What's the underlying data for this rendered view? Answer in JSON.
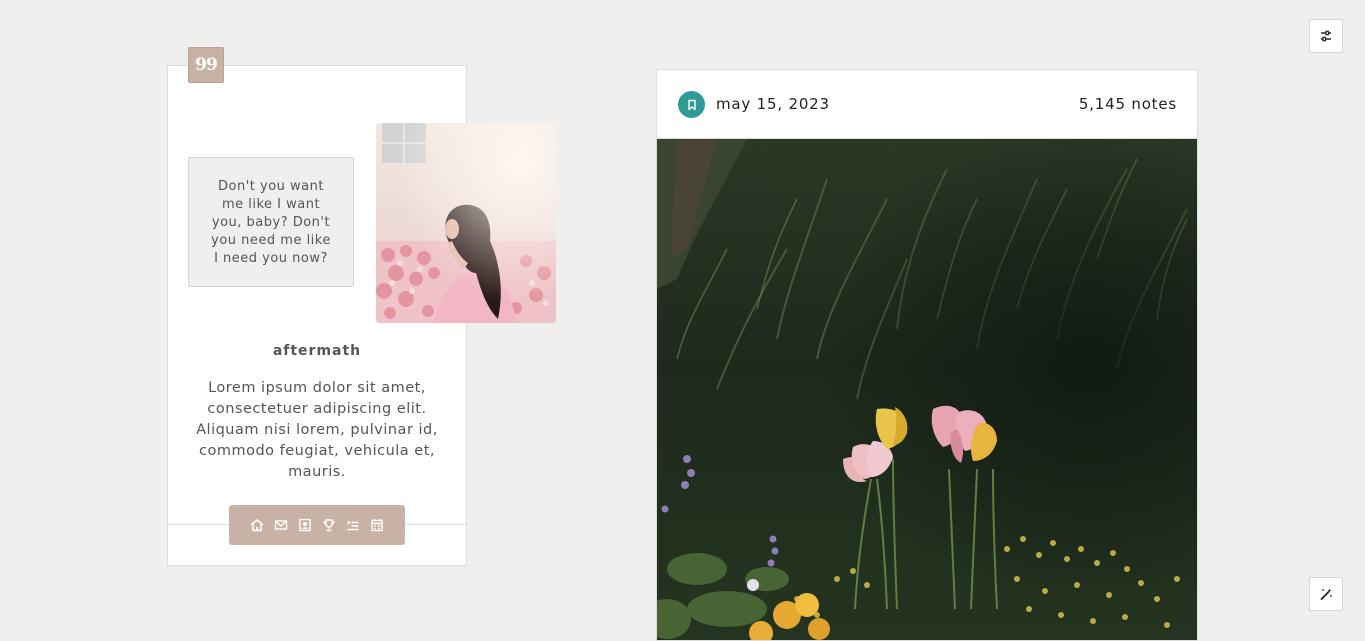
{
  "sidebar": {
    "quote_glyph": "99",
    "quote_text": "Don't you want me like I want you, baby? Don't you need me like I need you now?",
    "title": "aftermath",
    "description": "Lorem ipsum dolor sit amet, consectetuer adipiscing elit. Aliquam nisi lorem, pulvinar id, commodo feugiat, vehicula et, mauris.",
    "nav_icons": [
      "home-icon",
      "mail-icon",
      "portrait-icon",
      "trophy-icon",
      "list-icon",
      "calendar-icon"
    ]
  },
  "post": {
    "date": "may 15, 2023",
    "notes": "5,145 notes",
    "badge_icon": "bookmark-icon"
  },
  "controls": {
    "top_icon": "sliders-icon",
    "bottom_icon": "magic-wand-icon"
  },
  "colors": {
    "background": "#efefef",
    "accent_tan": "#c8b2a6",
    "accent_teal": "#2e9b97"
  }
}
